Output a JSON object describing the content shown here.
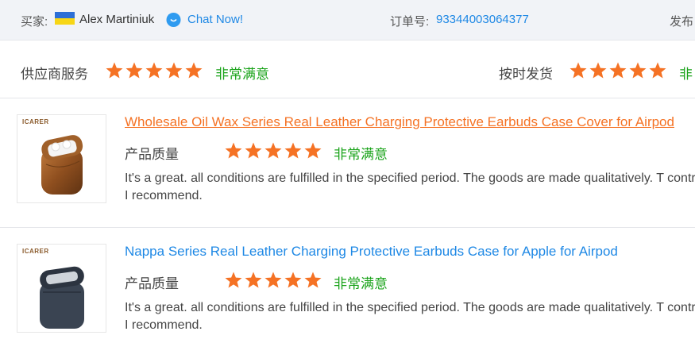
{
  "header": {
    "buyer_label": "买家:",
    "buyer_name": "Alex Martiniuk",
    "chat_label": "Chat Now!",
    "order_label": "订单号:",
    "order_number": "93344003064377",
    "ship_label_partial": "发布",
    "flag_colors": [
      "#2d6fd6",
      "#f7d616"
    ]
  },
  "supplier_ratings": {
    "service_label": "供应商服务",
    "service_stars": 5,
    "service_rating": "非常满意",
    "shipping_label": "按时发货",
    "shipping_stars": 5,
    "shipping_rating": "非"
  },
  "reviews": [
    {
      "title": "Wholesale Oil Wax Series Real Leather Charging Protective Earbuds Case Cover for Airpod",
      "thumb_brand": "ICARER",
      "quality_label": "产品质量",
      "stars": 5,
      "rating": "非常满意",
      "comment": "It's a great. all conditions are fulfilled in the specified period. The goods are made qualitatively. T control. I recommend."
    },
    {
      "title": "Nappa Series Real Leather Charging Protective Earbuds Case for Apple for Airpod",
      "thumb_brand": "ICARER",
      "quality_label": "产品质量",
      "stars": 5,
      "rating": "非常满意",
      "comment": "It's a great. all conditions are fulfilled in the specified period. The goods are made qualitatively. T control. I recommend."
    }
  ],
  "colors": {
    "star": "#f57224",
    "rating_green": "#1aa31a",
    "link_blue": "#1e88e5",
    "link_orange": "#f57224"
  }
}
